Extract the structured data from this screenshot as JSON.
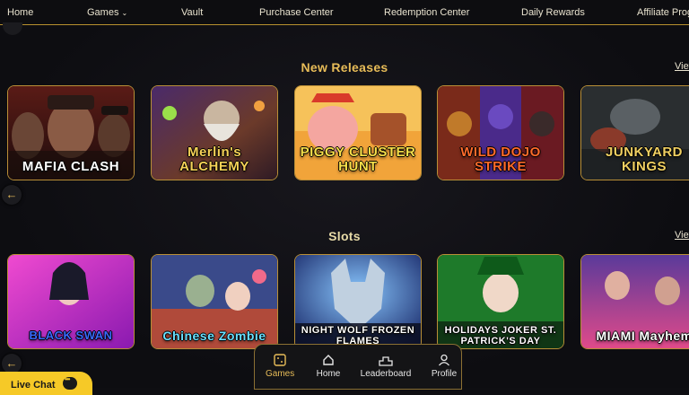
{
  "nav": {
    "items": [
      "Home",
      "Games",
      "Vault",
      "Purchase Center",
      "Redemption Center",
      "Daily Rewards",
      "Affiliate Prog"
    ]
  },
  "sections": [
    {
      "title": "New Releases",
      "view_all": "View All",
      "games": [
        "MAFIA CLASH",
        "Merlin's ALCHEMY",
        "PIGGY CLUSTER HUNT",
        "WILD DOJO STRIKE",
        "JUNKYARD KINGS"
      ]
    },
    {
      "title": "Slots",
      "view_all": "View All",
      "games": [
        "BLACK SWAN",
        "Chinese Zombie",
        "NIGHT WOLF FROZEN FLAMES",
        "HOLIDAYS JOKER ST. PATRICK'S DAY",
        "MIAMI Mayhem"
      ]
    }
  ],
  "bottom_nav": {
    "items": [
      "Games",
      "Home",
      "Leaderboard",
      "Profile"
    ],
    "active": "Games"
  },
  "live_chat": "Live Chat",
  "colors": {
    "accent": "#e7bc58",
    "border": "#b98f37",
    "chat": "#f6c927"
  }
}
